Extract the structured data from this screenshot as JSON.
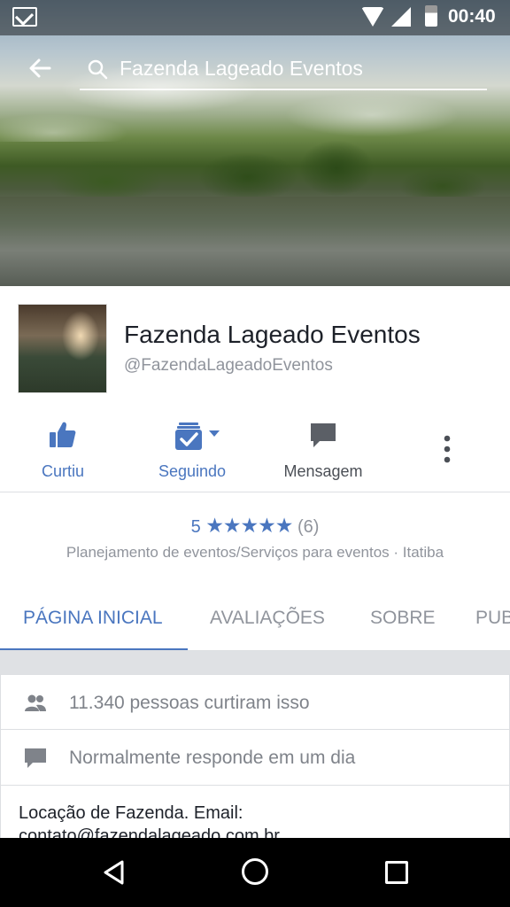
{
  "status_bar": {
    "time": "00:40"
  },
  "search": {
    "query": "Fazenda Lageado Eventos"
  },
  "page": {
    "name": "Fazenda Lageado Eventos",
    "handle": "@FazendaLageadoEventos"
  },
  "actions": [
    {
      "label": "Curtiu",
      "icon": "thumbs-up-icon",
      "active": true
    },
    {
      "label": "Seguindo",
      "icon": "following-check-icon",
      "active": true
    },
    {
      "label": "Mensagem",
      "icon": "message-bubble-icon",
      "active": false
    }
  ],
  "rating": {
    "score": "5",
    "stars": 5,
    "count": "(6)"
  },
  "category": "Planejamento de eventos/Serviços para eventos · Itatiba",
  "tabs": [
    {
      "label": "PÁGINA INICIAL",
      "active": true
    },
    {
      "label": "AVALIAÇÕES",
      "active": false
    },
    {
      "label": "SOBRE",
      "active": false
    },
    {
      "label": "PUB",
      "active": false
    }
  ],
  "info": {
    "likes": "11.340 pessoas curtiram isso",
    "response": "Normalmente responde em um dia",
    "about": "Locação de Fazenda. Email: contato@fazendalageado.com.br"
  },
  "colors": {
    "accent": "#4a76bf",
    "muted": "#90949c"
  }
}
